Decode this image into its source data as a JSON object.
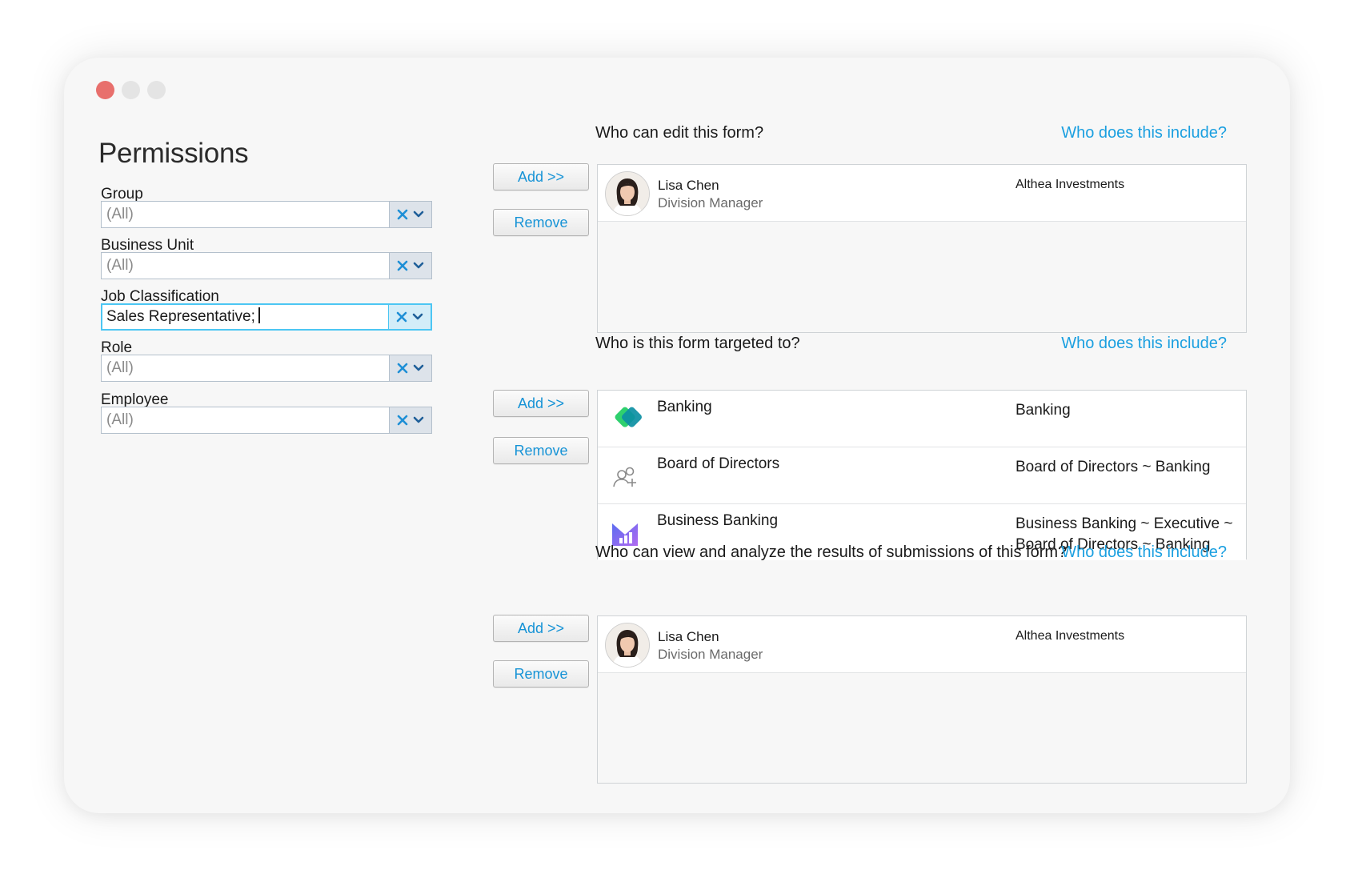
{
  "page": {
    "title": "Permissions"
  },
  "filters": [
    {
      "label": "Group",
      "value": "(All)",
      "focused": false
    },
    {
      "label": "Business Unit",
      "value": "(All)",
      "focused": false
    },
    {
      "label": "Job Classification",
      "value": "Sales Representative;",
      "focused": true
    },
    {
      "label": "Role",
      "value": "(All)",
      "focused": false
    },
    {
      "label": "Employee",
      "value": "(All)",
      "focused": false
    }
  ],
  "buttons": {
    "add": "Add >>",
    "remove": "Remove"
  },
  "sections": {
    "edit": {
      "title": "Who can edit this form?",
      "link": "Who does this include?",
      "items": [
        {
          "name": "Lisa Chen",
          "title": "Division Manager",
          "org": "Althea Investments",
          "icon": "avatar"
        }
      ]
    },
    "target": {
      "title": "Who is this form targeted to?",
      "link": "Who does this include?",
      "items": [
        {
          "name": "Banking",
          "desc1": "Banking",
          "desc2": "",
          "icon": "banking-logo-icon"
        },
        {
          "name": "Board of Directors",
          "desc1": "Board of Directors ~ Banking",
          "desc2": "",
          "icon": "add-user-group-icon"
        },
        {
          "name": "Business Banking",
          "desc1": "Business Banking ~ Executive ~",
          "desc2": "Board of Directors ~ Banking",
          "icon": "analytics-chart-icon"
        }
      ]
    },
    "view": {
      "title": "Who can view and analyze the results of submissions of this form?",
      "link": "Who does this include?",
      "items": [
        {
          "name": "Lisa Chen",
          "title": "Division Manager",
          "org": "Althea Investments",
          "icon": "avatar"
        }
      ]
    }
  },
  "colors": {
    "accent": "#1a9fe0",
    "focus": "#4cc6f3",
    "clear_icon": "#1e8fd6",
    "window_bg": "#f7f7f7",
    "close_dot": "#e86f6c"
  }
}
